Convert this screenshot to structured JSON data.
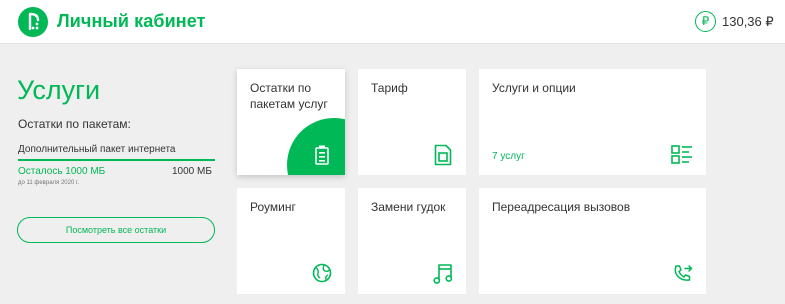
{
  "header": {
    "brand": "Личный кабинет",
    "logo_icon": "megafon-logo-icon",
    "currency_icon": "ruble-icon",
    "currency_symbol": "₽",
    "balance": "130,36 ₽"
  },
  "services": {
    "title": "Услуги",
    "packages_heading": "Остатки по пакетам:",
    "package": {
      "name": "Дополнительный пакет интернета",
      "remaining": "Осталось 1000 МБ",
      "total": "1000 МБ",
      "valid_until": "до 11 февраля 2020 г.",
      "remaining_fraction": 1.0
    },
    "remains_button": "Посмотреть все остатки"
  },
  "tiles": [
    {
      "label": "Остатки по пакетам услуг",
      "icon": "battery-icon",
      "active": true
    },
    {
      "label": "Тариф",
      "icon": "sim-card-icon"
    },
    {
      "label": "Услуги и опции",
      "sub": "7 услуг",
      "icon": "services-list-icon"
    },
    {
      "label": "Роуминг",
      "icon": "globe-icon"
    },
    {
      "label": "Замени гудок",
      "icon": "music-note-icon"
    },
    {
      "label": "Переадресация вызовов",
      "icon": "call-forward-icon"
    }
  ],
  "colors": {
    "accent": "#00b956",
    "background": "#efefef",
    "tile": "#ffffff",
    "text": "#333333"
  }
}
